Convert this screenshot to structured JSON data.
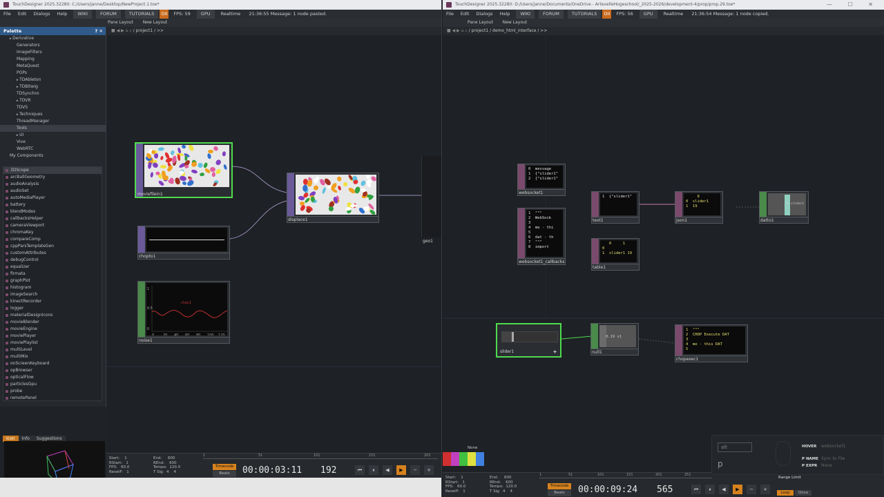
{
  "left": {
    "title": "TouchDesigner 2025.32280: C:/Users/janne/Desktop/NewProject.1.toe*",
    "menu": [
      "File",
      "Edit",
      "Dialogs",
      "Help"
    ],
    "toolbar": {
      "wiki": "WIKI",
      "forum": "FORUM",
      "tutorials": "TUTORIALS",
      "badge": "OII",
      "fps": "FPS: 59",
      "gpu": "GPU",
      "realtime": "Realtime",
      "message": "21:36:55 Message: 1 node pasted."
    },
    "pane": {
      "layout": "Pane Layout",
      "new_layout": "New Layout"
    },
    "path": "/ project1 / >>",
    "palette": {
      "title": "Palette",
      "tree": [
        {
          "label": "Derivative",
          "level": 0,
          "exp": true
        },
        {
          "label": "Generators",
          "level": 1
        },
        {
          "label": "ImageFilters",
          "level": 1
        },
        {
          "label": "Mapping",
          "level": 1
        },
        {
          "label": "MetaQuest",
          "level": 1
        },
        {
          "label": "POPs",
          "level": 1
        },
        {
          "label": "TDAbleton",
          "level": 1,
          "exp": true
        },
        {
          "label": "TDBitwig",
          "level": 1,
          "exp": true
        },
        {
          "label": "TDSynchro",
          "level": 1
        },
        {
          "label": "TDVR",
          "level": 1,
          "exp": true
        },
        {
          "label": "TDVS",
          "level": 1
        },
        {
          "label": "Techniques",
          "level": 1,
          "exp": true
        },
        {
          "label": "ThreadManager",
          "level": 1
        },
        {
          "label": "Tools",
          "level": 1,
          "sel": true
        },
        {
          "label": "UI",
          "level": 1,
          "exp": true
        },
        {
          "label": "Vive",
          "level": 1
        },
        {
          "label": "WebRTC",
          "level": 1
        },
        {
          "label": "My Components",
          "level": 0
        }
      ],
      "components": [
        "3DScope",
        "arcBallGeometry",
        "audioAnalysis",
        "audioSet",
        "autoMediaPlayer",
        "battery",
        "blendModes",
        "callbacksHelper",
        "cameraViewport",
        "chromaKey",
        "compareComp",
        "cppParsTemplateGen",
        "customAttributes",
        "debugControl",
        "equalizer",
        "firmata",
        "graphPlot",
        "histogram",
        "imageSearch",
        "kinectRecorder",
        "logger",
        "materialDesignIcons",
        "movieBlender",
        "movieEngine",
        "moviePlayer",
        "moviePlaylist",
        "multiLevel",
        "multiMix",
        "onScreenKeyboard",
        "opBrowser",
        "opticalFlow",
        "particlesGpu",
        "probe",
        "remotePanel"
      ]
    },
    "info_tabs": [
      "Icon",
      "Info",
      "Suggestions"
    ],
    "nodes": {
      "moviefilein": "moviefilein1",
      "chopto": "chopto1",
      "noise": "noise1",
      "displace": "displace1",
      "geo": "geo1",
      "noise_label": "chan1"
    },
    "noise_ticks": {
      "y": [
        "1",
        "0.5",
        "0"
      ],
      "x": [
        "0",
        "20",
        "40",
        "60",
        "80",
        "100",
        "120"
      ]
    },
    "timeline": {
      "info": "Start:    1\nRStart:   1\nFPS:   60.0\nResetF:   1",
      "info2": "End:     600\nREnd:    600\nTempo:  120.0\nT Sig:  4    4",
      "ruler": [
        "1",
        "51",
        "101",
        "151",
        "201"
      ],
      "timecode_btn": "Timecode",
      "beats_btn": "Beats",
      "timecode": "00:00:03:11",
      "frame": "192"
    }
  },
  "right": {
    "title": "TouchDesigner 2025.32280: D:/Users/janne/Documents/OneDrive - ArtevelleHogeschool/_2025-2026/development-4/prop/prop.29.toe*",
    "menu": [
      "File",
      "Edit",
      "Dialogs",
      "Help"
    ],
    "toolbar": {
      "wiki": "WIKI",
      "forum": "FORUM",
      "tutorials": "TUTORIALS",
      "badge": "OII",
      "fps": "FPS: 56",
      "gpu": "GPU",
      "realtime": "Realtime",
      "message": "21:36:54 Message: 1 node copied."
    },
    "pane": {
      "layout": "Pane Layout",
      "new_layout": "New Layout"
    },
    "path": "/ project1 / demo_html_interface / >>",
    "nodes": {
      "websocket": "websocket1",
      "websocket_text": "0  message\n1  {\"slider1\"\n2  {\"slider1\"",
      "callbacks": "websocket1_callbacks",
      "callbacks_text": "1  \"\"\"\n2  WebSock\n3\n4  me - thi\n5\n6  dat - th\n7  \"\"\"\n8  import",
      "text": "text1",
      "text_text": "1  {\"slider1\"",
      "json": "json1",
      "json_text": "     0\n0  slider1\n1  19",
      "datto": "datto1",
      "datto_text": "19 slider1",
      "table": "table1",
      "table_text": "   0     1\n0\n1  slider1 19",
      "slider": "slider1",
      "null": "null1",
      "null_text": "0.19 v1",
      "chopexec": "chopexec1",
      "chopexec_text": "1  \"\"\"\n2  CHOP Execute DAT\n3\n4  me - this DAT\n5"
    },
    "color_label": "None",
    "timeline": {
      "info": "Start:    1\nRStart:   1\nFPS:   60.0\nResetF:   1",
      "info2": "End:     600\nREnd:    600\nTempo:  120.0\nT Sig:  4    4",
      "ruler": [
        "1",
        "51",
        "101",
        "151",
        "201",
        "251"
      ],
      "timecode_btn": "Timecode",
      "beats_btn": "Beats",
      "timecode": "00:00:09:24",
      "frame": "565",
      "range_limit": "Range Limit",
      "loop": "Loop",
      "once": "Once"
    },
    "hud": {
      "key": "alt",
      "letter": "p",
      "hover_lbl": "HOVER",
      "hover_val": "websocket1",
      "pname_lbl": "P NAME",
      "pname_val": "Sync to File",
      "pexpr_lbl": "P EXPR",
      "pexpr_val": "None"
    }
  },
  "colors": {
    "accent": "#d6821e",
    "select": "#4fdc4f",
    "palette_head": "#2f5a8a"
  }
}
